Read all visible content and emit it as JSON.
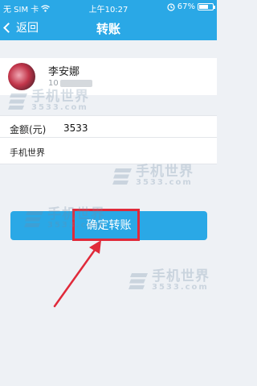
{
  "status_bar": {
    "carrier": "无 SIM 卡",
    "time": "上午10:27",
    "battery_text": "67%",
    "battery_level": 0.67
  },
  "nav": {
    "back_label": "返回",
    "title": "转账"
  },
  "recipient": {
    "name": "李安娜",
    "account_partial": "10"
  },
  "amount": {
    "label": "金额(元)",
    "value": "3533"
  },
  "remark": {
    "text": "手机世界"
  },
  "confirm_button": {
    "label": "确定转账"
  },
  "watermark": {
    "cn": "手机世界",
    "num": "3533.com"
  },
  "colors": {
    "accent": "#2aa8e6",
    "highlight": "#e02a3a",
    "background": "#eef1f5"
  }
}
